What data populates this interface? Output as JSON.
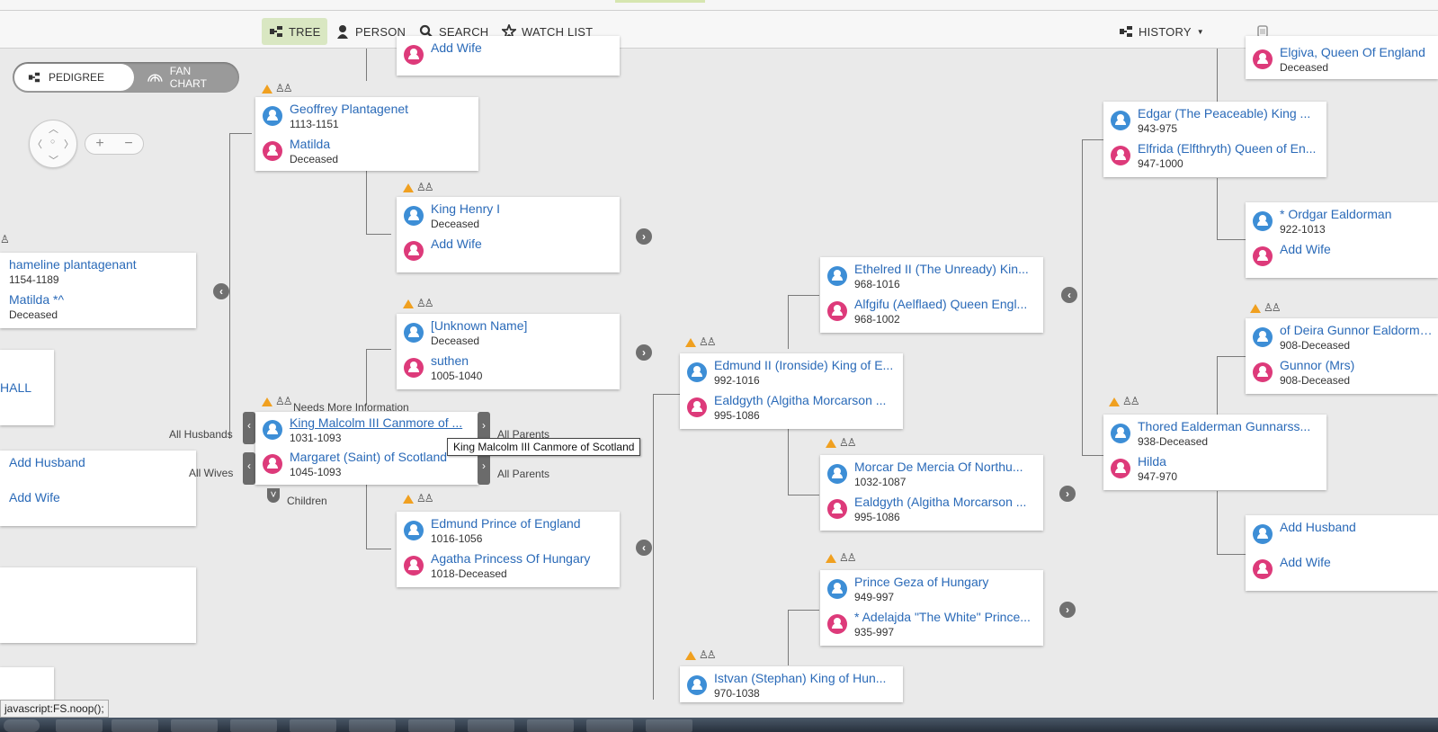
{
  "nav": {
    "tree": "TREE",
    "person": "PERSON",
    "search": "SEARCH",
    "watch_list": "WATCH LIST",
    "history": "HISTORY"
  },
  "view_toggle": {
    "pedigree": "PEDIGREE",
    "fan_chart": "FAN CHART"
  },
  "focus": {
    "needs_info": "Needs More Information",
    "all_husbands": "All Husbands",
    "all_wives": "All Wives",
    "all_parents_1": "All Parents",
    "all_parents_2": "All Parents",
    "children": "Children",
    "tooltip": "King Malcolm III Canmore of Scotland"
  },
  "status_bar": "javascript:FS.noop();",
  "cards": {
    "c1": {
      "a_name": "Geoffrey Plantagenet",
      "a_date": "1113-1151",
      "b_name": "Matilda",
      "b_date": "Deceased"
    },
    "c2": {
      "a_name": "Add Wife"
    },
    "c3": {
      "a_name": "King Henry I",
      "a_date": "Deceased",
      "b_name": "Add Wife"
    },
    "c4": {
      "a_name": "hameline plantagenant",
      "a_date": "1154-1189",
      "b_name": "Matilda *^",
      "b_date": "Deceased"
    },
    "c5": {
      "a_name": "HALL"
    },
    "c6": {
      "a_name": "Add Husband",
      "b_name": "Add Wife"
    },
    "c7": {
      "a_name": "[Unknown Name]",
      "a_date": "Deceased",
      "b_name": "suthen",
      "b_date": "1005-1040"
    },
    "c8": {
      "a_name": "King Malcolm III Canmore of ...",
      "a_date": "1031-1093",
      "b_name": "Margaret (Saint) of Scotland",
      "b_date": "1045-1093"
    },
    "c9": {
      "a_name": "Edmund Prince of England",
      "a_date": "1016-1056",
      "b_name": "Agatha Princess Of Hungary",
      "b_date": "1018-Deceased"
    },
    "c10": {
      "a_name": "Edmund II (Ironside) King of E...",
      "a_date": "992-1016",
      "b_name": "Ealdgyth (Algitha Morcarson ...",
      "b_date": "995-1086"
    },
    "c11": {
      "a_name": "Istvan (Stephan) King of Hun...",
      "a_date": "970-1038"
    },
    "c12": {
      "a_name": "Ethelred II (The Unready) Kin...",
      "a_date": "968-1016",
      "b_name": "Alfgifu (Aelflaed) Queen Engl...",
      "b_date": "968-1002"
    },
    "c13": {
      "a_name": "Morcar De Mercia Of Northu...",
      "a_date": "1032-1087",
      "b_name": "Ealdgyth (Algitha Morcarson ...",
      "b_date": "995-1086"
    },
    "c14": {
      "a_name": "Prince Geza of Hungary",
      "a_date": "949-997",
      "b_name": "* Adelajda \"The White\" Prince...",
      "b_date": "935-997"
    },
    "c15": {
      "a_name": "Elgiva, Queen Of England",
      "a_date": "Deceased"
    },
    "c16": {
      "a_name": "Edgar (The Peaceable) King ...",
      "a_date": "943-975",
      "b_name": "Elfrida (Elfthryth) Queen of En...",
      "b_date": "947-1000"
    },
    "c17": {
      "a_name": "* Ordgar Ealdorman",
      "a_date": "922-1013",
      "b_name": "Add Wife"
    },
    "c18": {
      "a_name": "of Deira Gunnor Ealdorman",
      "a_date": "908-Deceased",
      "b_name": "Gunnor (Mrs)",
      "b_date": "908-Deceased"
    },
    "c19": {
      "a_name": "Thored Ealderman Gunnarss...",
      "a_date": "938-Deceased",
      "b_name": "Hilda",
      "b_date": "947-970"
    },
    "c20": {
      "a_name": "Add Husband",
      "b_name": "Add Wife"
    }
  },
  "colors": {
    "link": "#2a6ab8",
    "male": "#3d8ed6",
    "female": "#dd3a7a",
    "warning": "#f0a020",
    "active_tab": "#d9e7c2"
  }
}
